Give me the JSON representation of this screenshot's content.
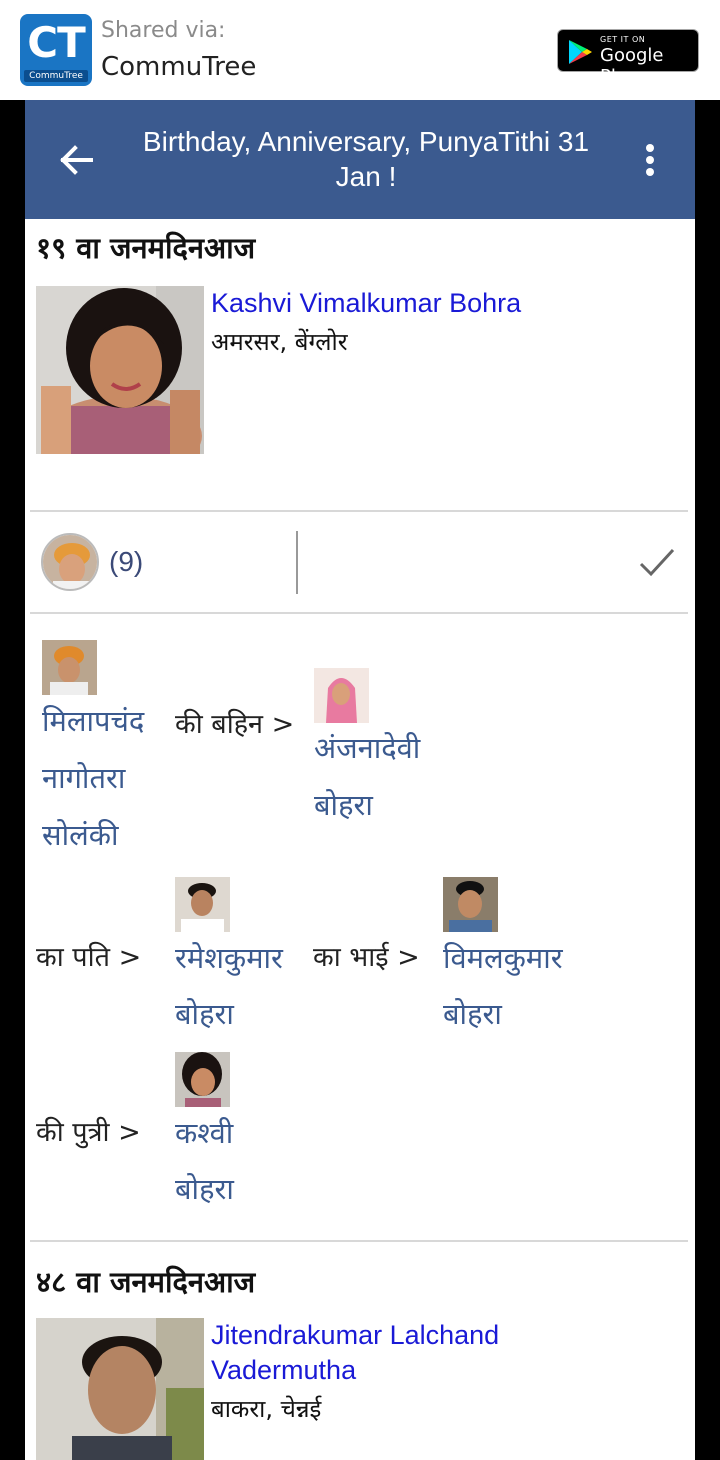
{
  "share": {
    "logo_letters": "CT",
    "logo_caption": "CommuTree",
    "shared_via": "Shared via:",
    "app_name": "CommuTree",
    "store_get": "GET IT ON",
    "store_name": "Google Play"
  },
  "toolbar": {
    "title": "Birthday, Anniversary, PunyaTithi 31 Jan !",
    "back_icon": "arrow-left-icon",
    "menu_icon": "more-vertical-icon",
    "color": "#3b5a8f"
  },
  "entries": [
    {
      "heading": "१९ वा जनमदिनआज",
      "name": "Kashvi Vimalkumar Bohra",
      "place": "अमरसर, बेंग्लोर"
    },
    {
      "heading": "४८ वा जनमदिनआज",
      "name": "Jitendrakumar Lalchand Vadermutha",
      "place": "बाकरा, चेन्नई"
    }
  ],
  "reactions": {
    "count": "(9)",
    "check_icon": "check-icon"
  },
  "relation": {
    "person1": "मिलापचंद नागोतरा सोलंकी",
    "rel1": "की बहिन >",
    "person2": "अंजनादेवी बोहरा",
    "rel2": "का पति >",
    "person3": "रमेशकुमार बोहरा",
    "rel3": "का भाई >",
    "person4": "विमलकुमार बोहरा",
    "rel4": "की पुत्री >",
    "person5": "कश्वी बोहरा"
  }
}
